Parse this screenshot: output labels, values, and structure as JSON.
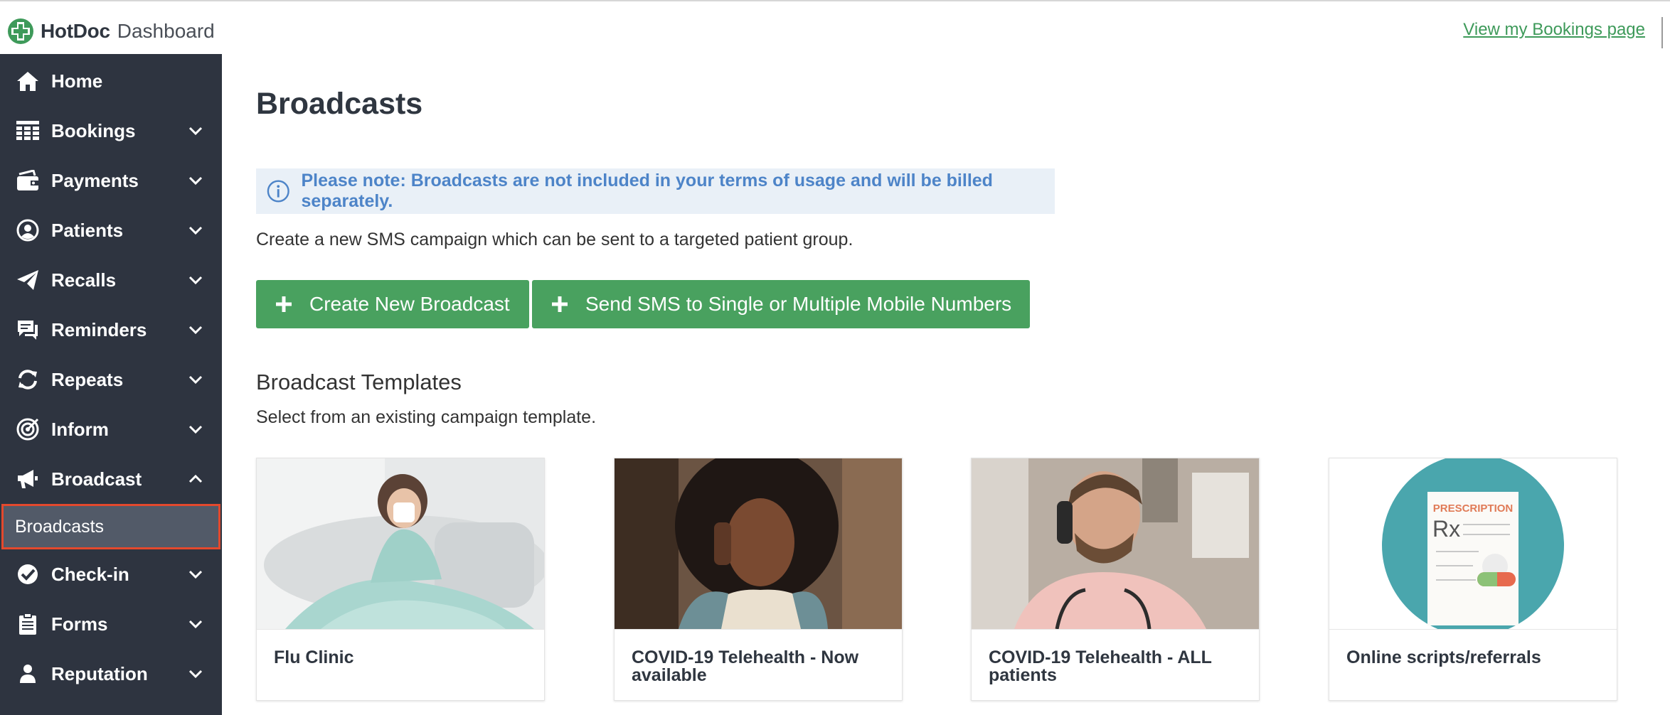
{
  "header": {
    "brand": "HotDoc",
    "product": "Dashboard",
    "bookings_link": "View my Bookings page"
  },
  "sidebar": {
    "items": [
      {
        "label": "Home",
        "icon": "home-icon",
        "chevron": "none"
      },
      {
        "label": "Bookings",
        "icon": "grid-icon",
        "chevron": "down"
      },
      {
        "label": "Payments",
        "icon": "wallet-icon",
        "chevron": "down"
      },
      {
        "label": "Patients",
        "icon": "user-circle-icon",
        "chevron": "down"
      },
      {
        "label": "Recalls",
        "icon": "paper-plane-icon",
        "chevron": "down"
      },
      {
        "label": "Reminders",
        "icon": "chat-icon",
        "chevron": "down"
      },
      {
        "label": "Repeats",
        "icon": "sync-icon",
        "chevron": "down"
      },
      {
        "label": "Inform",
        "icon": "target-icon",
        "chevron": "down"
      },
      {
        "label": "Broadcast",
        "icon": "megaphone-icon",
        "chevron": "up"
      },
      {
        "label": "Check-in",
        "icon": "check-circle-icon",
        "chevron": "down"
      },
      {
        "label": "Forms",
        "icon": "clipboard-icon",
        "chevron": "down"
      },
      {
        "label": "Reputation",
        "icon": "person-icon",
        "chevron": "down"
      }
    ],
    "subitem": {
      "label": "Broadcasts",
      "active": true
    }
  },
  "main": {
    "title": "Broadcasts",
    "notice": "Please note: Broadcasts are not included in your terms of usage and will be billed separately.",
    "description": "Create a new SMS campaign which can be sent to a targeted patient group.",
    "buttons": {
      "create": "Create New Broadcast",
      "send_sms": "Send SMS to Single or Multiple Mobile Numbers"
    },
    "templates_title": "Broadcast Templates",
    "templates_description": "Select from an existing campaign template.",
    "templates": [
      {
        "title": "Flu Clinic"
      },
      {
        "title": "COVID-19 Telehealth - Now available"
      },
      {
        "title": "COVID-19 Telehealth - ALL patients"
      },
      {
        "title": "Online scripts/referrals",
        "illustration_text": "PRESCRIPTION",
        "rx_symbol": "Rx"
      }
    ]
  },
  "colors": {
    "sidebar_bg": "#2e3440",
    "accent_green": "#49a15f",
    "link_green": "#3e9a5a",
    "notice_bg": "#e9f0f7",
    "notice_text": "#4d84c8",
    "active_outline": "#e4492d"
  }
}
